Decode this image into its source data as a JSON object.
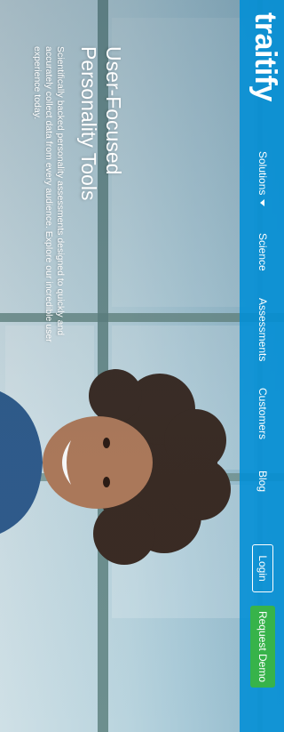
{
  "brand": {
    "logo_text": "traitify",
    "nav_color": "#008ed6",
    "cta_color": "#37b34a"
  },
  "nav": {
    "items": [
      {
        "label": "Solutions",
        "has_dropdown": true
      },
      {
        "label": "Science"
      },
      {
        "label": "Assessments"
      },
      {
        "label": "Customers"
      },
      {
        "label": "Blog"
      }
    ],
    "login_label": "Login",
    "demo_label": "Request Demo"
  },
  "hero": {
    "title_line1": "User-Focused",
    "title_line2": "Personality Tools",
    "description": "Scientifically backed personality assessments designed to quickly and accurately collect data from every audience. Explore our incredible user experience today."
  }
}
